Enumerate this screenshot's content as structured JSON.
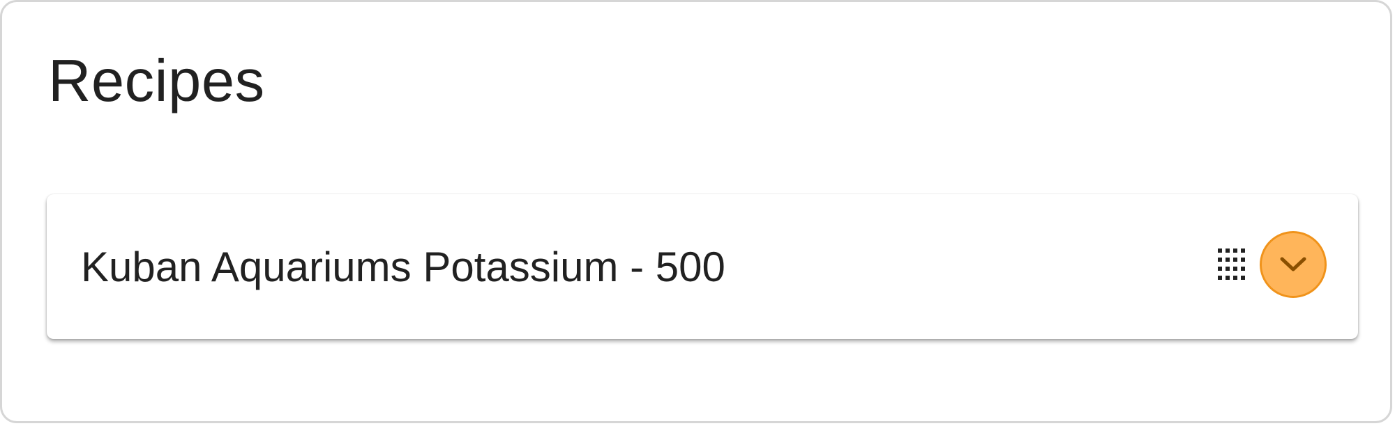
{
  "page": {
    "title": "Recipes"
  },
  "recipes": [
    {
      "name": "Kuban Aquariums Potassium - 500",
      "drag_icon": "drag-handle-grid-icon",
      "expand_icon": "chevron-down-icon"
    }
  ],
  "colors": {
    "expand_button_fill": "#ffb55a",
    "expand_button_border": "#f0931b",
    "chevron": "#8a4f00",
    "text": "#212121",
    "frame_border": "#d6d6d6"
  }
}
